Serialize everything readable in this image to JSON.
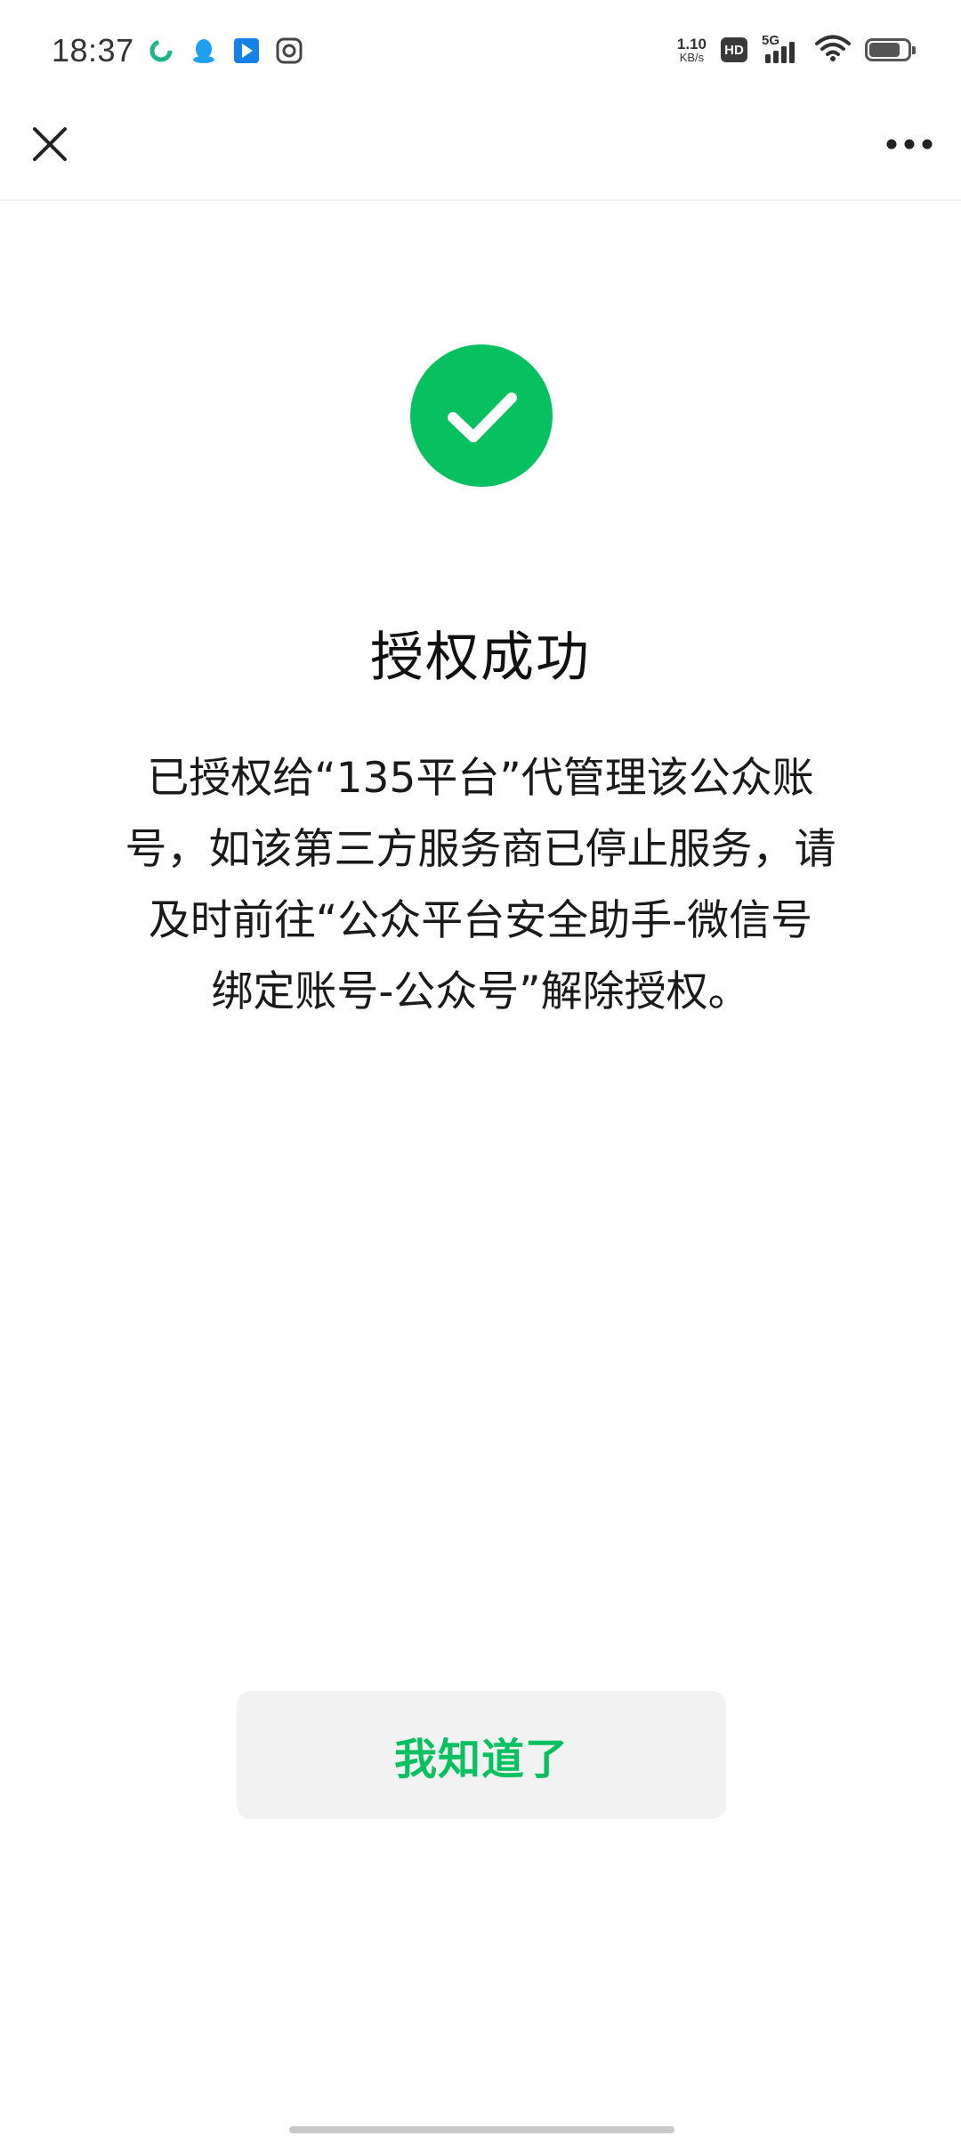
{
  "status_bar": {
    "time": "18:37",
    "net_speed_value": "1.10",
    "net_speed_unit": "KB/s",
    "hd_label": "HD",
    "network_label": "5G",
    "battery_level": 0.8,
    "app_icons": [
      "app-green-swirl-icon",
      "qq-penguin-icon",
      "blue-play-app-icon",
      "gallery-app-icon"
    ]
  },
  "nav": {
    "close_icon": "close-icon",
    "more_icon": "more-dots-icon"
  },
  "main": {
    "status_icon": "success-check-icon",
    "accent_color": "#07c160",
    "title": "授权成功",
    "description_lines": [
      "已授权给“135平台”代管理该公众账",
      "号，如该第三方服务商已停止服务，请",
      "及时前往“公众平台安全助手-微信号",
      "绑定账号-公众号”解除授权。"
    ]
  },
  "actions": {
    "ok_label": "我知道了"
  }
}
